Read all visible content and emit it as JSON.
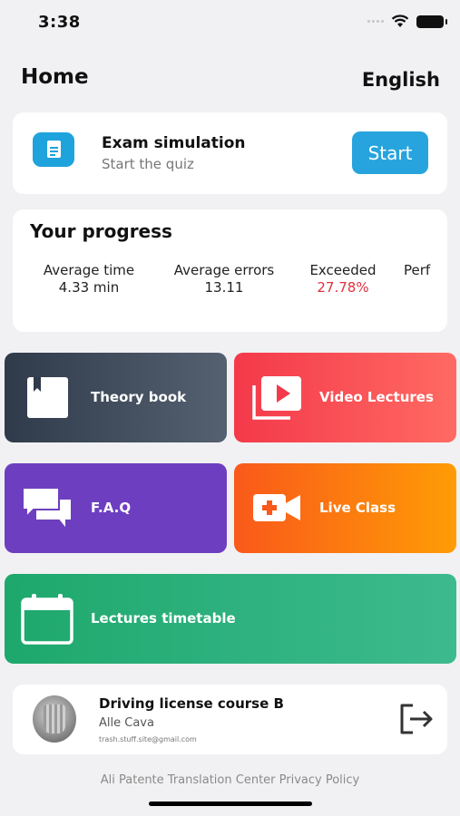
{
  "status_bar": {
    "time": "3:38"
  },
  "header": {
    "title": "Home",
    "language": "English"
  },
  "exam": {
    "title": "Exam simulation",
    "subtitle": "Start the quiz",
    "button": "Start",
    "icon": "document-icon"
  },
  "progress": {
    "title": "Your progress",
    "stats": [
      {
        "label": "Average time",
        "value": "4.33 min"
      },
      {
        "label": "Average errors",
        "value": "13.11"
      },
      {
        "label": "Exceeded",
        "value": "27.78%"
      },
      {
        "label": "Perf",
        "value": ""
      }
    ]
  },
  "tiles": {
    "theory": {
      "label": "Theory book",
      "icon": "book-icon",
      "color": "#2f3a4a"
    },
    "video": {
      "label": "Video Lectures",
      "icon": "video-library-icon",
      "color": "#f4394a"
    },
    "faq": {
      "label": "F.A.Q",
      "icon": "chat-bubbles-icon",
      "color": "#6d3fc0"
    },
    "live": {
      "label": "Live Class",
      "icon": "video-camera-add-icon",
      "color": "#f9591a"
    },
    "timetable": {
      "label": "Lectures timetable",
      "icon": "calendar-icon",
      "color": "#1ea86c"
    }
  },
  "profile": {
    "course": "Driving license course B",
    "author": "Alle Cava",
    "email": "trash.stuff.site@gmail.com"
  },
  "footer": {
    "text": "Ali Patente Translation Center Privacy Policy"
  }
}
